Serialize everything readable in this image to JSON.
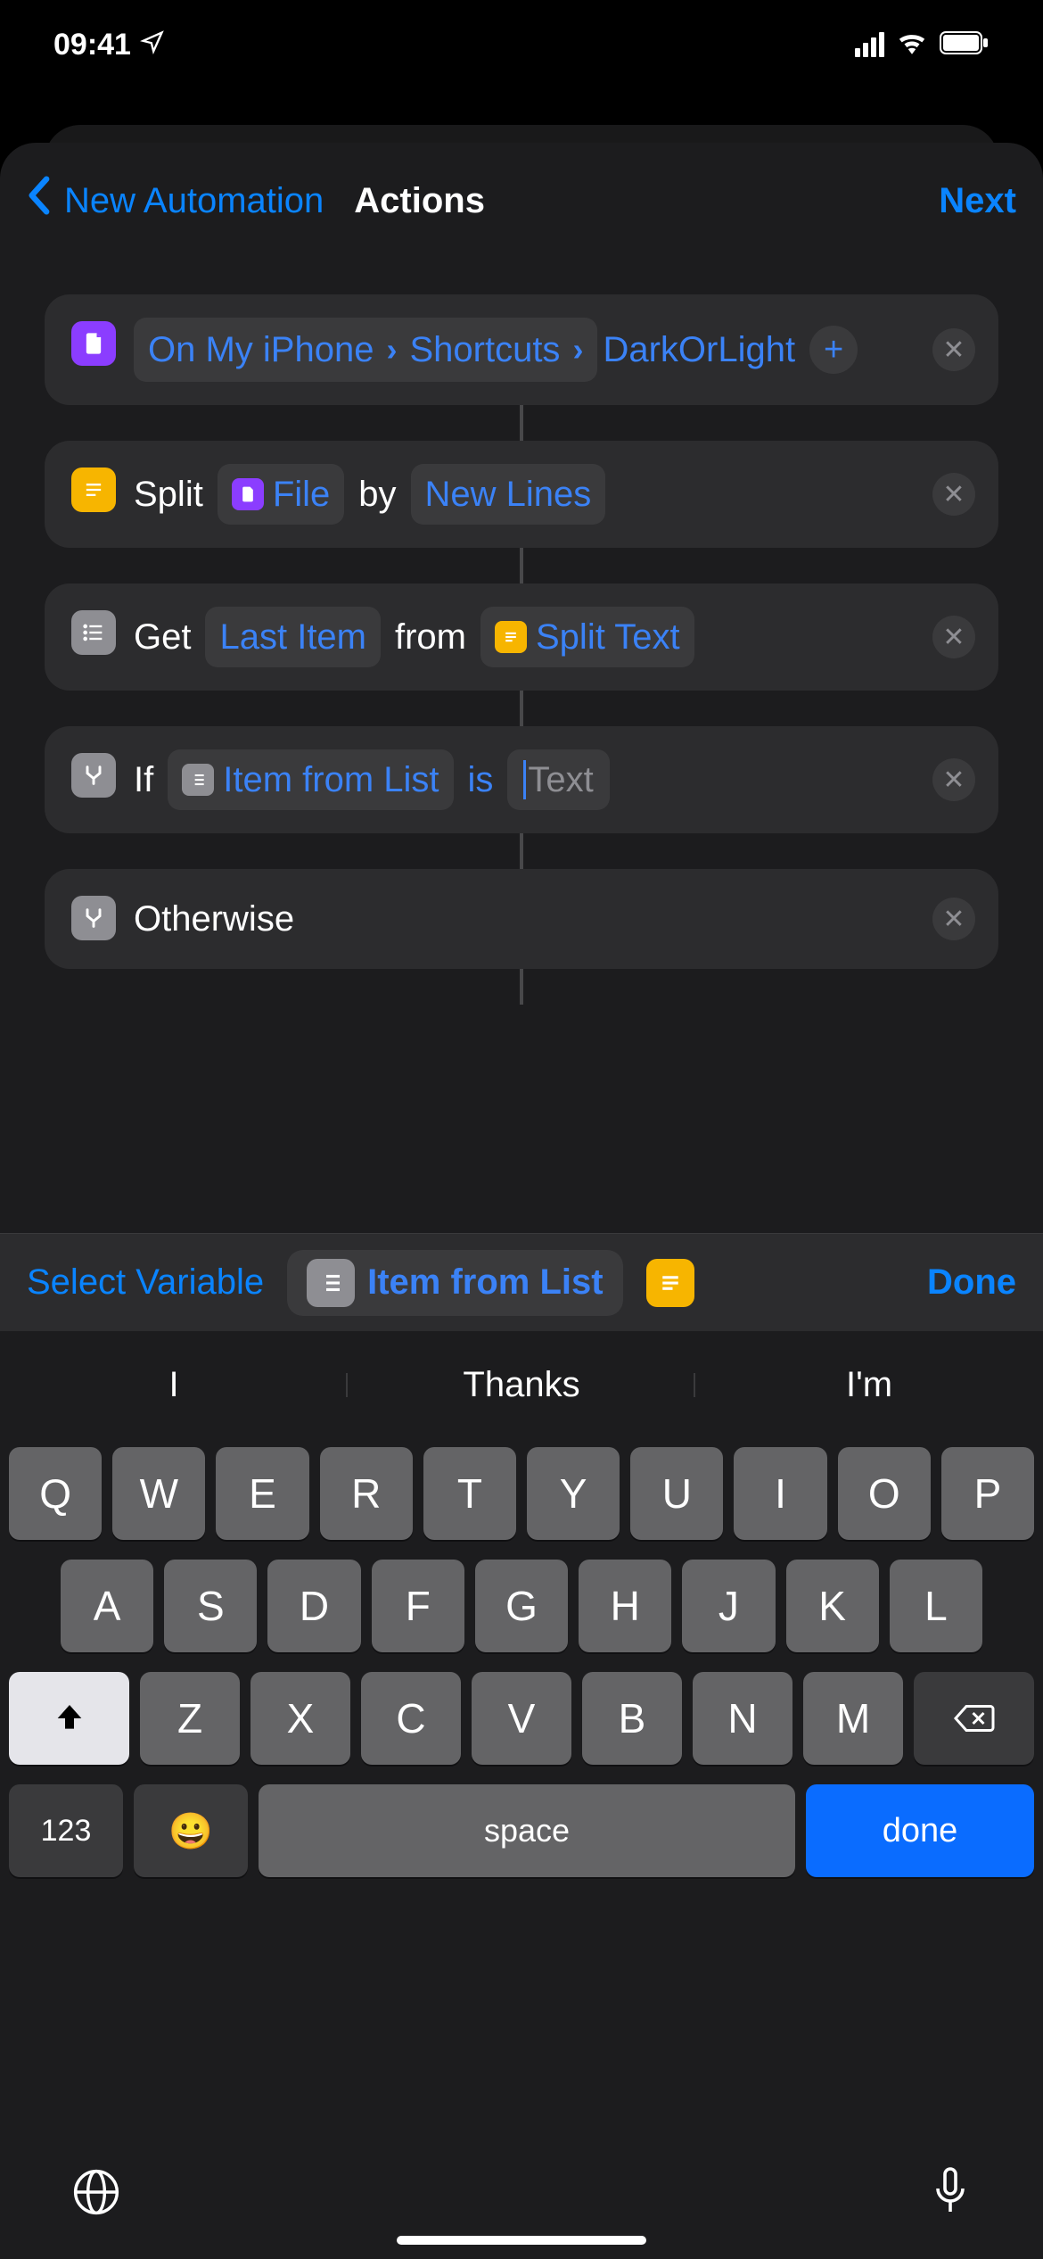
{
  "status": {
    "time": "09:41"
  },
  "nav": {
    "back_label": "New Automation",
    "title": "Actions",
    "next": "Next"
  },
  "actions": {
    "file_path": {
      "segments": [
        "On My iPhone",
        "Shortcuts"
      ],
      "filename": "DarkOrLight"
    },
    "split": {
      "verb": "Split",
      "file_token": "File",
      "by": "by",
      "mode": "New Lines"
    },
    "get": {
      "verb": "Get",
      "which": "Last Item",
      "from": "from",
      "source": "Split Text"
    },
    "if": {
      "verb": "If",
      "var": "Item from List",
      "op": "is",
      "placeholder": "Text"
    },
    "otherwise": {
      "label": "Otherwise"
    }
  },
  "var_toolbar": {
    "select": "Select Variable",
    "chip": "Item from List",
    "done": "Done"
  },
  "keyboard": {
    "predictions": [
      "I",
      "Thanks",
      "I'm"
    ],
    "row1": [
      "Q",
      "W",
      "E",
      "R",
      "T",
      "Y",
      "U",
      "I",
      "O",
      "P"
    ],
    "row2": [
      "A",
      "S",
      "D",
      "F",
      "G",
      "H",
      "J",
      "K",
      "L"
    ],
    "row3": [
      "Z",
      "X",
      "C",
      "V",
      "B",
      "N",
      "M"
    ],
    "numkey": "123",
    "space": "space",
    "done": "done"
  }
}
